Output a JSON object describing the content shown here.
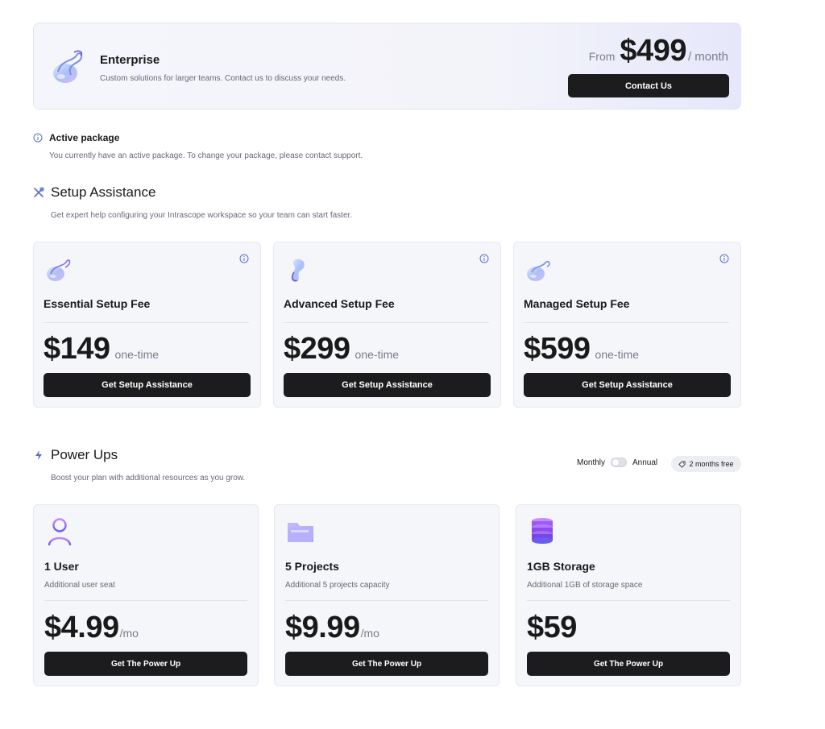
{
  "enterprise": {
    "title": "Enterprise",
    "description": "Custom solutions for larger teams. Contact us to discuss your needs.",
    "from_label": "From",
    "price": "$499",
    "period": "/ month",
    "button_label": "Contact Us",
    "logo_icon": "glass-swirl-icon"
  },
  "notice": {
    "title": "Active package",
    "description": "You currently have an active package. To change your package, please contact support.",
    "icon": "info-icon"
  },
  "setup": {
    "title": "Setup Assistance",
    "description": "Get expert help configuring your Intrascope workspace so your team can start faster.",
    "icon": "tools-icon",
    "cards": [
      {
        "name": "Essential Setup Fee",
        "price": "$149",
        "unit": "one-time",
        "button": "Get Setup Assistance"
      },
      {
        "name": "Advanced Setup Fee",
        "price": "$299",
        "unit": "one-time",
        "button": "Get Setup Assistance"
      },
      {
        "name": "Managed Setup Fee",
        "price": "$599",
        "unit": "one-time",
        "button": "Get Setup Assistance"
      }
    ]
  },
  "powerups": {
    "title": "Power Ups",
    "description": "Boost your plan with additional resources as you grow.",
    "icon": "lightning-icon",
    "toggle": {
      "left_label": "Monthly",
      "right_label": "Annual",
      "selected": "Monthly"
    },
    "promo": "2 months free",
    "cards": [
      {
        "name": "1 User",
        "sub": "Additional user seat",
        "price": "$4.99",
        "unit": "/mo",
        "button": "Get The Power Up",
        "icon": "user-icon"
      },
      {
        "name": "5 Projects",
        "sub": "Additional 5 projects capacity",
        "price": "$9.99",
        "unit": "/mo",
        "button": "Get The Power Up",
        "icon": "folder-icon"
      },
      {
        "name": "1GB Storage",
        "sub": "Additional 1GB of storage space",
        "price": "$59",
        "unit": "",
        "button": "Get The Power Up",
        "icon": "database-icon"
      }
    ]
  },
  "colors": {
    "accent": "#5b6bd6",
    "button_bg": "#1c1c1e",
    "card_bg": "#f5f6fa"
  }
}
